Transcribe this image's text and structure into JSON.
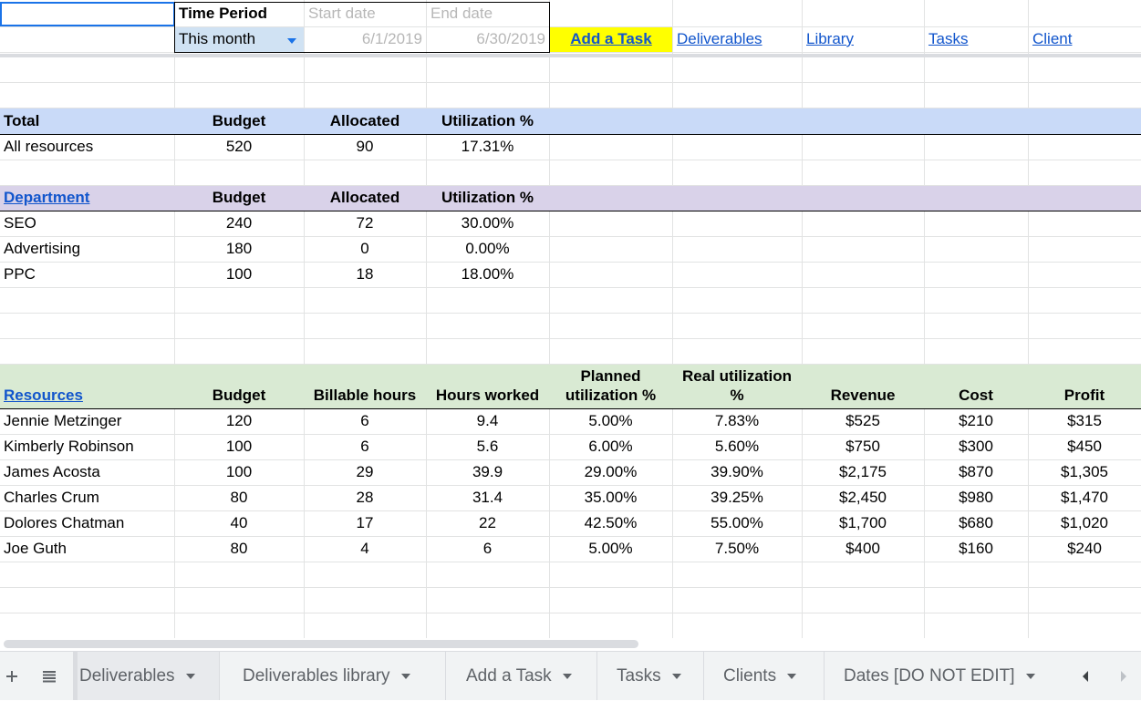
{
  "top": {
    "time_period_label": "Time Period",
    "time_period_value": "This month",
    "start_date_label": "Start date",
    "end_date_label": "End date",
    "start_date": "6/1/2019",
    "end_date": "6/30/2019",
    "links": [
      "Add a Task",
      "Deliverables",
      "Library",
      "Tasks",
      "Client"
    ]
  },
  "total": {
    "headers": [
      "Total",
      "Budget",
      "Allocated",
      "Utilization %"
    ],
    "rows": [
      [
        "All resources",
        "520",
        "90",
        "17.31%"
      ]
    ]
  },
  "department": {
    "headers": [
      "Department",
      "Budget",
      "Allocated",
      "Utilization %"
    ],
    "rows": [
      [
        "SEO",
        "240",
        "72",
        "30.00%"
      ],
      [
        "Advertising",
        "180",
        "0",
        "0.00%"
      ],
      [
        "PPC",
        "100",
        "18",
        "18.00%"
      ]
    ]
  },
  "resources": {
    "headers": [
      "Resources",
      "Budget",
      "Billable hours",
      "Hours worked",
      "Planned utilization %",
      "Real utilization %",
      "Revenue",
      "Cost",
      "Profit"
    ],
    "rows": [
      [
        "Jennie Metzinger",
        "120",
        "6",
        "9.4",
        "5.00%",
        "7.83%",
        "$525",
        "$210",
        "$315"
      ],
      [
        "Kimberly Robinson",
        "100",
        "6",
        "5.6",
        "6.00%",
        "5.60%",
        "$750",
        "$300",
        "$450"
      ],
      [
        "James Acosta",
        "100",
        "29",
        "39.9",
        "29.00%",
        "39.90%",
        "$2,175",
        "$870",
        "$1,305"
      ],
      [
        "Charles Crum",
        "80",
        "28",
        "31.4",
        "35.00%",
        "39.25%",
        "$2,450",
        "$980",
        "$1,470"
      ],
      [
        "Dolores Chatman",
        "40",
        "17",
        "22",
        "42.50%",
        "55.00%",
        "$1,700",
        "$680",
        "$1,020"
      ],
      [
        "Joe Guth",
        "80",
        "4",
        "6",
        "5.00%",
        "7.50%",
        "$400",
        "$160",
        "$240"
      ]
    ]
  },
  "tabs": [
    "Deliverables",
    "Deliverables library",
    "Add a Task",
    "Tasks",
    "Clients",
    "Dates [DO NOT EDIT]"
  ],
  "icons": {
    "add_sheet": "plus-icon",
    "all_sheets": "list-icon",
    "scroll_left": "chevron-left-icon",
    "scroll_right": "chevron-right-icon"
  },
  "colors": {
    "total_header": "#c9daf8",
    "department_header": "#d9d2e9",
    "resources_header": "#d9ead3",
    "add_task_highlight": "#ffff00",
    "link": "#1155cc"
  }
}
